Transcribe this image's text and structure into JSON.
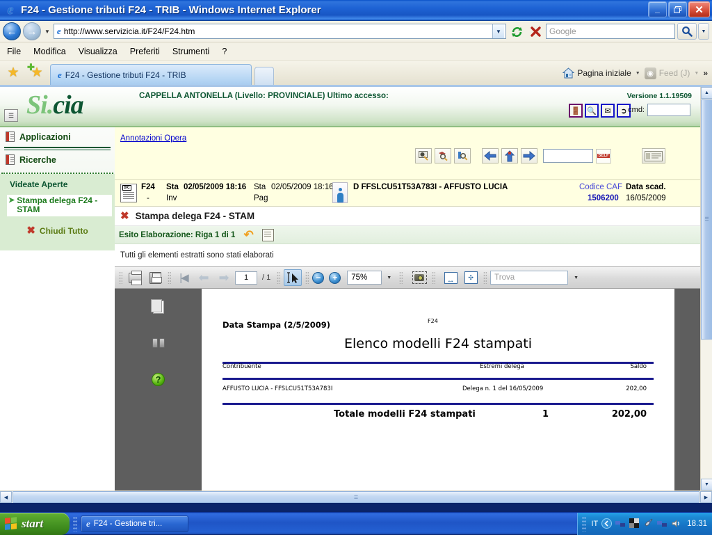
{
  "window": {
    "title": "F24 - Gestione tributi F24 - TRIB - Windows Internet Explorer",
    "minimize_label": "_",
    "maximize_label": "❐",
    "close_label": "✕"
  },
  "address_bar": {
    "url": "http://www.servizicia.it/F24/F24.htm",
    "back_icon": "back-arrow-icon",
    "forward_icon": "forward-arrow-icon",
    "refresh_icon": "refresh-icon",
    "stop_icon": "stop-icon",
    "search_placeholder": "Google",
    "search_icon": "magnifier-icon"
  },
  "menu": {
    "items": [
      "File",
      "Modifica",
      "Visualizza",
      "Preferiti",
      "Strumenti",
      "?"
    ]
  },
  "tabs": {
    "favorites_icon": "star-icon",
    "add_favorite_icon": "star-plus-icon",
    "open": [
      {
        "label": "F24 - Gestione tributi F24 - TRIB",
        "icon": "ie-icon",
        "active": true
      }
    ],
    "new_tab_label": "",
    "home_label": "Pagina iniziale",
    "feed_label": "Feed (J)",
    "overflow_label": "»"
  },
  "app_header": {
    "logo_part1": "Si.",
    "logo_part2": "cia",
    "user_line": "CAPPELLA ANTONELLA (Livello: PROVINCIALE) Ultimo accesso:",
    "version": "Versione 1.1.19509",
    "cmd_label": "cmd:",
    "cmd_value": "",
    "collapse_icon": "collapse-panel-icon",
    "icons": [
      "exit-door-icon",
      "search-doc-icon",
      "envelope-icon",
      "logout-icon"
    ]
  },
  "sidebar": {
    "applicazioni": "Applicazioni",
    "ricerche": "Ricerche",
    "videate_header": "Videate Aperte",
    "open_item": "Stampa delega F24 - STAM",
    "close_all": "Chiudi Tutto"
  },
  "info_bar": {
    "annotations_link": "Annotazioni Opera",
    "toolbar_icons": [
      "preview-icon",
      "search-record-icon",
      "detail-search-icon",
      "prev-record-icon",
      "up-record-icon",
      "next-record-icon"
    ],
    "input_value": "",
    "self_icon": "self-icon",
    "card_icon": "id-card-icon"
  },
  "record": {
    "doc_icon": "declaration-icon",
    "type": "F24",
    "dash": "-",
    "sta_inv_label1": "Sta",
    "sta_inv_label2": "Inv",
    "sta_inv_date": "02/05/2009 18:16",
    "sta_pag_label1": "Sta",
    "sta_pag_label2": "Pag",
    "sta_pag_date": "02/05/2009 18:16",
    "person_icon": "person-icon",
    "subject": "D FFSLCU51T53A783I - AFFUSTO LUCIA",
    "codice_caf_label": "Codice CAF",
    "codice_caf_value": "1506200",
    "data_scad_label": "Data scad.",
    "data_scad_value": "16/05/2009"
  },
  "page_title": {
    "icon": "close-x-icon",
    "text": "Stampa delega F24 - STAM"
  },
  "esito": {
    "label": "Esito Elaborazione: Riga 1 di 1",
    "undo_icon": "undo-arrow-icon",
    "note_icon": "edit-note-icon",
    "message": "Tutti gli elementi estratti sono stati elaborati"
  },
  "pdf_toolbar": {
    "print_icon": "print-icon",
    "save_icon": "save-icon",
    "first_page_icon": "first-page-icon",
    "prev_page_icon": "previous-page-icon",
    "next_page_icon": "next-page-icon",
    "page_number": "1",
    "page_total": "/ 1",
    "select_tool_icon": "text-select-cursor-icon",
    "zoom_out_icon": "zoom-out-icon",
    "zoom_out_label": "−",
    "zoom_in_icon": "zoom-in-icon",
    "zoom_in_label": "+",
    "zoom_value": "75%",
    "snapshot_icon": "snapshot-camera-icon",
    "fit_width_icon": "fit-width-icon",
    "fit_page_icon": "fit-page-icon",
    "find_placeholder": "Trova"
  },
  "pdf_sidebar": {
    "pages_icon": "pages-panel-icon",
    "search_icon": "binoculars-icon",
    "help_icon": "help-icon"
  },
  "document": {
    "print_date": "Data Stampa (2/5/2009)",
    "form_code": "F24",
    "title": "Elenco modelli F24 stampati",
    "columns": [
      "Contribuente",
      "Estremi delega",
      "Saldo"
    ],
    "rows": [
      {
        "contribuente": "AFFUSTO LUCIA - FFSLCU51T53A783I",
        "estremi": "Delega n. 1 del 16/05/2009",
        "saldo": "202,00"
      }
    ],
    "total_label": "Totale modelli F24 stampati",
    "total_count": "1",
    "total_amount": "202,00"
  },
  "taskbar": {
    "start_label": "start",
    "items": [
      {
        "label": "F24 - Gestione tri...",
        "icon": "ie-icon"
      }
    ],
    "tray": {
      "language": "IT",
      "icons": [
        "show-hidden-icon",
        "network-icon",
        "display-icon",
        "rocket-icon",
        "network2-icon",
        "volume-icon"
      ],
      "clock": "18.31"
    }
  },
  "colors": {
    "brand_green_light": "#7cc47a",
    "brand_green_dark": "#0d5632",
    "title_blue": "#1856c4",
    "doc_rule": "#1b1b8f",
    "link_blue": "#0000cd"
  }
}
